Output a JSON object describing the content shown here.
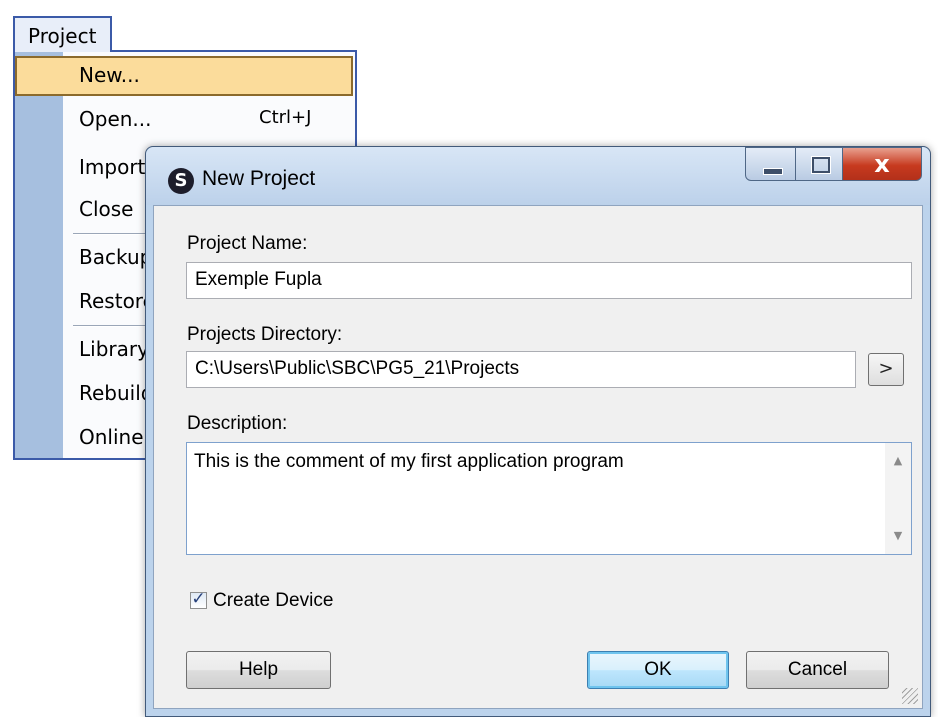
{
  "menu": {
    "title": "Project",
    "items": [
      {
        "label": "New...",
        "shortcut": "",
        "selected": true
      },
      {
        "label": "Open...",
        "shortcut": "Ctrl+J"
      },
      {
        "label": "Import",
        "shortcut": ""
      },
      {
        "label": "Close",
        "shortcut": ""
      },
      {
        "label": "Backup",
        "shortcut": ""
      },
      {
        "label": "Restore",
        "shortcut": ""
      },
      {
        "label": "Library",
        "shortcut": ""
      },
      {
        "label": "Rebuild",
        "shortcut": ""
      },
      {
        "label": "Online",
        "shortcut": ""
      }
    ]
  },
  "dialog": {
    "title": "New Project",
    "app_icon": "saia-s-icon",
    "app_icon_glyph": "S",
    "close_glyph": "x",
    "project_name": {
      "label": "Project Name:",
      "value": "Exemple Fupla"
    },
    "projects_directory": {
      "label": "Projects Directory:",
      "value": "C:\\Users\\Public\\SBC\\PG5_21\\Projects",
      "browse_label": ">"
    },
    "description": {
      "label": "Description:",
      "value": "This is the comment of my first application program"
    },
    "create_device": {
      "label": "Create Device",
      "checked": true,
      "check_glyph": "✓"
    },
    "buttons": {
      "help": "Help",
      "ok": "OK",
      "cancel": "Cancel"
    },
    "colors": {
      "title_bar": "#bcd3ec",
      "close_button": "#c73a1f",
      "default_button": "#bee6fd"
    }
  }
}
